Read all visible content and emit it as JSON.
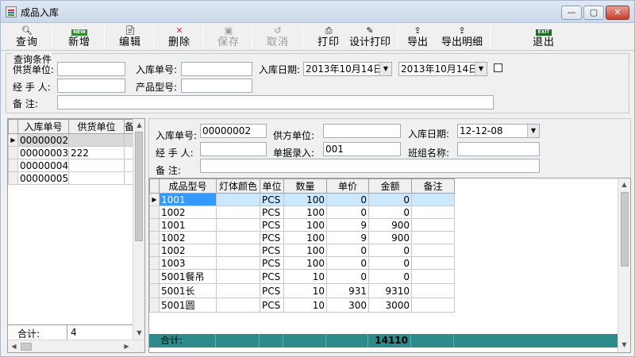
{
  "window": {
    "title": "成品入库",
    "min": "—",
    "max": "▢",
    "close": "✕"
  },
  "toolbar": {
    "query": "查询",
    "add": "新增",
    "edit": "编辑",
    "delete": "删除",
    "save": "保存",
    "cancel": "取消",
    "print": "打印",
    "design_print": "设计打印",
    "export": "导出",
    "export_detail": "导出明细",
    "exit": "退出",
    "new_badge": "NEW",
    "exit_badge": "EXIT"
  },
  "query": {
    "group_title": "查询条件",
    "supplier_label": "供货单位:",
    "supplier_value": "",
    "in_no_label": "入库单号:",
    "in_no_value": "",
    "date_label": "入库日期:",
    "date_from": "2013年10月14日",
    "date_to": "2013年10月14日",
    "handler_label": "经 手 人:",
    "handler_value": "",
    "model_label": "产品型号:",
    "model_value": "",
    "note_label": "备    注:",
    "note_value": ""
  },
  "list": {
    "columns": [
      "入库单号",
      "供货单位",
      "备"
    ],
    "rows": [
      {
        "no": "00000002",
        "supplier": ""
      },
      {
        "no": "00000003",
        "supplier": "222"
      },
      {
        "no": "00000004",
        "supplier": ""
      },
      {
        "no": "00000005",
        "supplier": ""
      }
    ],
    "total_label": "合计:",
    "total_value": "4"
  },
  "form": {
    "in_no_label": "入库单号:",
    "in_no_value": "00000002",
    "supplier_label": "供方单位:",
    "supplier_value": "",
    "date_label": "入库日期:",
    "date_value": "12-12-08",
    "handler_label": "经 手 人:",
    "handler_value": "",
    "entry_label": "单据录入:",
    "entry_value": "001",
    "team_label": "班组名称:",
    "team_value": "",
    "note_label": "备    注:",
    "note_value": ""
  },
  "detail": {
    "columns": [
      "成品型号",
      "灯体颜色",
      "单位",
      "数量",
      "单价",
      "金额",
      "备注"
    ],
    "rows": [
      {
        "model": "1001",
        "color": "",
        "unit": "PCS",
        "qty": "100",
        "price": "0",
        "amount": "0",
        "note": ""
      },
      {
        "model": "1002",
        "color": "",
        "unit": "PCS",
        "qty": "100",
        "price": "0",
        "amount": "0",
        "note": ""
      },
      {
        "model": "1001",
        "color": "",
        "unit": "PCS",
        "qty": "100",
        "price": "9",
        "amount": "900",
        "note": ""
      },
      {
        "model": "1002",
        "color": "",
        "unit": "PCS",
        "qty": "100",
        "price": "9",
        "amount": "900",
        "note": ""
      },
      {
        "model": "1002",
        "color": "",
        "unit": "PCS",
        "qty": "100",
        "price": "0",
        "amount": "0",
        "note": ""
      },
      {
        "model": "1003",
        "color": "",
        "unit": "PCS",
        "qty": "100",
        "price": "0",
        "amount": "0",
        "note": ""
      },
      {
        "model": "5001餐吊",
        "color": "",
        "unit": "PCS",
        "qty": "10",
        "price": "0",
        "amount": "0",
        "note": ""
      },
      {
        "model": "5001长",
        "color": "",
        "unit": "PCS",
        "qty": "10",
        "price": "931",
        "amount": "9310",
        "note": ""
      },
      {
        "model": "5001圆",
        "color": "",
        "unit": "PCS",
        "qty": "10",
        "price": "300",
        "amount": "3000",
        "note": ""
      }
    ],
    "total_label": "合计:",
    "total_amount": "14110"
  },
  "colors": {
    "selected_row": "#cce8ff",
    "total_bar": "#2e8b8b",
    "highlight_cell": "#3399ff"
  }
}
